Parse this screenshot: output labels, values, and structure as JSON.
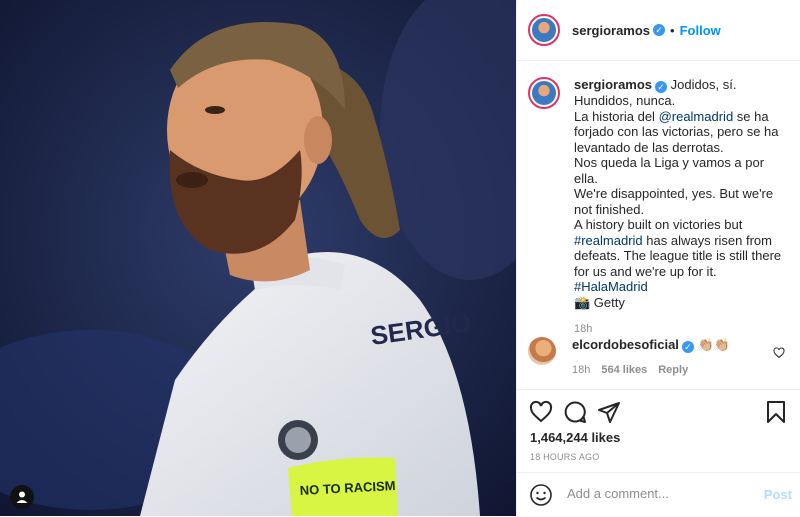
{
  "post": {
    "author": "sergioramos",
    "follow_label": "Follow",
    "separator": "•"
  },
  "caption": {
    "author": "sergioramos",
    "line1": "Jodidos, sí. Hundidos, nunca.",
    "line2_pre": "La historia del ",
    "mention": "@realmadrid",
    "line2_post": " se ha forjado con las victorias, pero se ha levantado de las derrotas.",
    "line3": "Nos queda la Liga y vamos a por ella.",
    "line4": "We're disappointed, yes. But we're not finished.",
    "line5": "A history built on victories but",
    "hashtag1": "#realmadrid",
    "line6": " has always risen from defeats. The league title is still there for us and we're up for it.",
    "hashtag2": "#HalaMadrid",
    "credit": "📸 Getty",
    "time": "18h"
  },
  "comment": {
    "author": "elcordobesoficial",
    "text": "👏🏼👏🏼",
    "time": "18h",
    "likes": "564 likes",
    "reply": "Reply"
  },
  "stats": {
    "likes": "1,464,244 likes",
    "ago": "18 HOURS AGO"
  },
  "add_comment": {
    "placeholder": "Add a comment...",
    "post_label": "Post"
  },
  "jersey": {
    "name": "SERGIO",
    "armband": "NO TO RACISM"
  },
  "colors": {
    "follow": "#0095f6",
    "link": "#00376b",
    "verified": "#3897f0",
    "post_disabled": "#b2dffc",
    "armband": "#d7f542"
  }
}
